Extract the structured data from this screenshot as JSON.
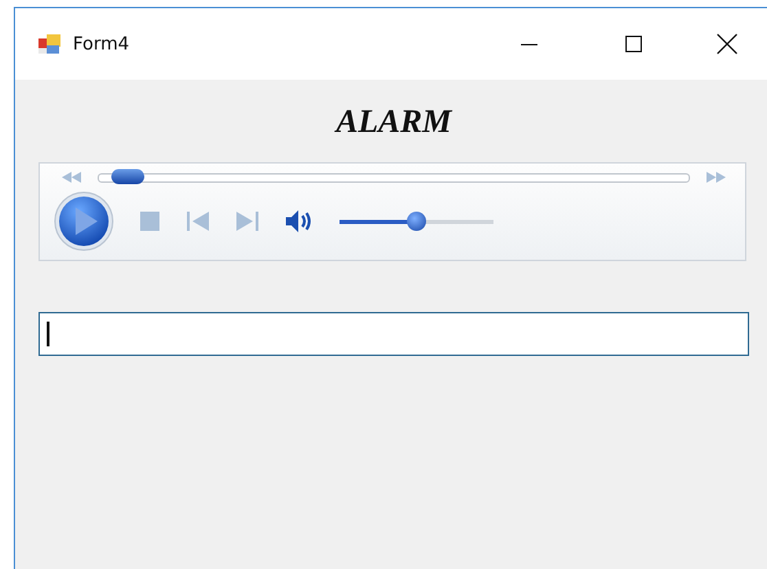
{
  "window": {
    "title": "Form4"
  },
  "heading": "ALARM",
  "player": {
    "seek": {
      "level": 0.02
    },
    "volume": {
      "level": 0.5
    }
  },
  "text_field": {
    "focused": true
  }
}
